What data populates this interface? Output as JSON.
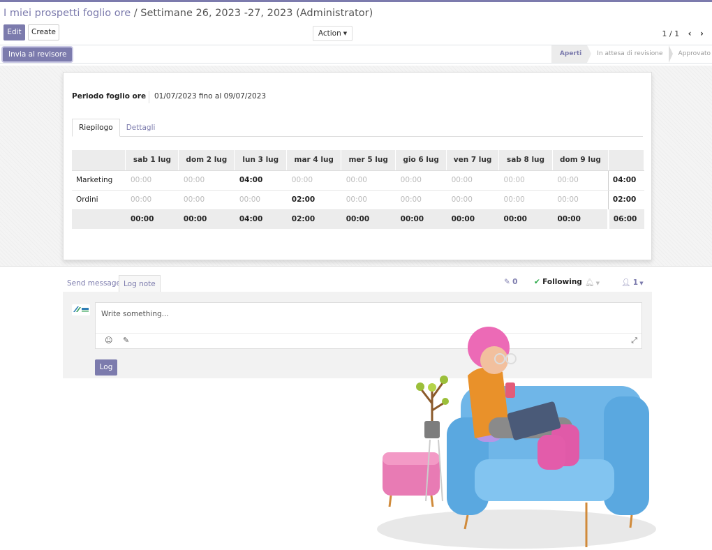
{
  "breadcrumb": {
    "parent": "I miei prospetti foglio ore",
    "separator": " / ",
    "current": "Settimane 26, 2023 -27, 2023 (Administrator)"
  },
  "toolbar": {
    "edit_label": "Edit",
    "create_label": "Create",
    "action_label": "Action"
  },
  "pager": {
    "value": "1 / 1"
  },
  "statusbar": {
    "submit_label": "Invia al revisore",
    "stages": [
      {
        "label": "Aperti",
        "active": true
      },
      {
        "label": "In attesa di revisione",
        "active": false
      },
      {
        "label": "Approvato",
        "active": false
      }
    ]
  },
  "form": {
    "period_label": "Periodo foglio ore",
    "period_value": "01/07/2023 fino al 09/07/2023",
    "tabs": [
      {
        "label": "Riepilogo",
        "active": true
      },
      {
        "label": "Dettagli",
        "active": false
      }
    ]
  },
  "grid": {
    "columns": [
      "sab 1 lug",
      "dom 2 lug",
      "lun 3 lug",
      "mar 4 lug",
      "mer 5 lug",
      "gio 6 lug",
      "ven 7 lug",
      "sab 8 lug",
      "dom 9 lug"
    ],
    "rows": [
      {
        "name": "Marketing",
        "cells": [
          "00:00",
          "00:00",
          "04:00",
          "00:00",
          "00:00",
          "00:00",
          "00:00",
          "00:00",
          "00:00"
        ],
        "total": "04:00"
      },
      {
        "name": "Ordini",
        "cells": [
          "00:00",
          "00:00",
          "00:00",
          "02:00",
          "00:00",
          "00:00",
          "00:00",
          "00:00",
          "00:00"
        ],
        "total": "02:00"
      }
    ],
    "footer": {
      "cells": [
        "00:00",
        "00:00",
        "04:00",
        "02:00",
        "00:00",
        "00:00",
        "00:00",
        "00:00",
        "00:00"
      ],
      "total": "06:00"
    }
  },
  "chatter": {
    "send_message": "Send message",
    "log_note": "Log note",
    "attachments_count": "0",
    "following_label": "Following",
    "followers_count": "1",
    "placeholder": "Write something...",
    "log_button": "Log"
  },
  "colors": {
    "brand": "#7c7bad",
    "following_check": "#28a745"
  }
}
